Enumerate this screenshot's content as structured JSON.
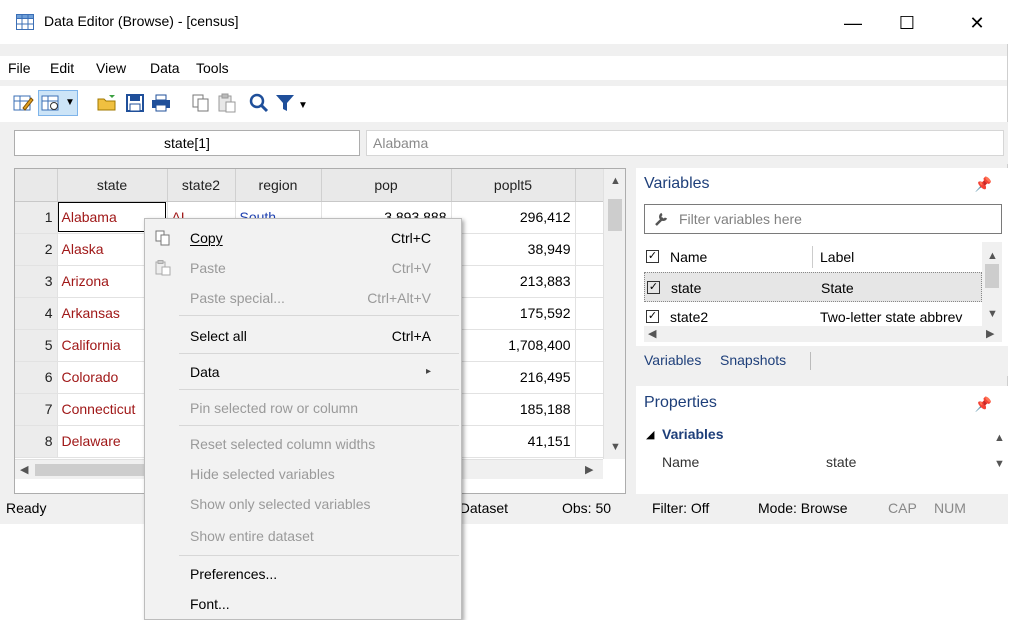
{
  "window": {
    "title": "Data Editor (Browse) - [census]",
    "minimize": "—",
    "maximize": "☐",
    "close": "✕"
  },
  "menu": [
    "File",
    "Edit",
    "View",
    "Data",
    "Tools"
  ],
  "toolbar": {
    "icons": [
      "edit-mode-icon",
      "browse-mode-icon",
      "dropdown-icon",
      "open-icon",
      "save-icon",
      "print-icon",
      "copy-icon",
      "paste-icon",
      "find-icon",
      "filter-icon",
      "filter-dropdown-icon"
    ]
  },
  "address": {
    "cellref": "state[1]",
    "value": "Alabama"
  },
  "grid": {
    "columns": [
      "state",
      "state2",
      "region",
      "pop",
      "poplt5"
    ],
    "rows": [
      {
        "n": "1",
        "state": "Alabama",
        "state2": "AL",
        "region": "South",
        "pop": "3,893,888",
        "poplt5": "296,412"
      },
      {
        "n": "2",
        "state": "Alaska",
        "state2": "",
        "region": "",
        "pop": "",
        "poplt5": "38,949"
      },
      {
        "n": "3",
        "state": "Arizona",
        "state2": "",
        "region": "",
        "pop": "",
        "poplt5": "213,883"
      },
      {
        "n": "4",
        "state": "Arkansas",
        "state2": "",
        "region": "",
        "pop": "",
        "poplt5": "175,592"
      },
      {
        "n": "5",
        "state": "California",
        "state2": "",
        "region": "",
        "pop": "",
        "poplt5": "1,708,400"
      },
      {
        "n": "6",
        "state": "Colorado",
        "state2": "",
        "region": "",
        "pop": "",
        "poplt5": "216,495"
      },
      {
        "n": "7",
        "state": "Connecticut",
        "state2": "",
        "region": "",
        "pop": "",
        "poplt5": "185,188"
      },
      {
        "n": "8",
        "state": "Delaware",
        "state2": "",
        "region": "",
        "pop": "",
        "poplt5": "41,151"
      }
    ]
  },
  "variables_panel": {
    "title": "Variables",
    "filter_placeholder": "Filter variables here",
    "headers": {
      "name": "Name",
      "label": "Label"
    },
    "rows": [
      {
        "name": "state",
        "label": "State"
      },
      {
        "name": "state2",
        "label": "Two-letter state abbrev"
      }
    ],
    "tabs": [
      "Variables",
      "Snapshots"
    ]
  },
  "properties_panel": {
    "title": "Properties",
    "section": "Variables",
    "rows": [
      {
        "key": "Name",
        "value": "state"
      }
    ]
  },
  "status": {
    "ready": "Ready",
    "dataset": ": Dataset",
    "obs": "Obs: 50",
    "filter": "Filter: Off",
    "mode": "Mode: Browse",
    "cap": "CAP",
    "num": "NUM"
  },
  "context_menu": {
    "items": [
      {
        "label": "Copy",
        "shortcut": "Ctrl+C",
        "enabled": true,
        "icon": "copy-icon"
      },
      {
        "label": "Paste",
        "shortcut": "Ctrl+V",
        "enabled": false,
        "icon": "paste-icon"
      },
      {
        "label": "Paste special...",
        "shortcut": "Ctrl+Alt+V",
        "enabled": false
      },
      {
        "label": "Select all",
        "shortcut": "Ctrl+A",
        "enabled": true
      },
      {
        "label": "Data",
        "shortcut": "▸",
        "enabled": true
      },
      {
        "label": "Pin selected row or column",
        "enabled": false
      },
      {
        "label": "Reset selected column widths",
        "enabled": false
      },
      {
        "label": "Hide selected variables",
        "enabled": false
      },
      {
        "label": "Show only selected variables",
        "enabled": false
      },
      {
        "label": "Show entire dataset",
        "enabled": false
      },
      {
        "label": "Preferences...",
        "enabled": true
      },
      {
        "label": "Font...",
        "enabled": true
      }
    ]
  }
}
